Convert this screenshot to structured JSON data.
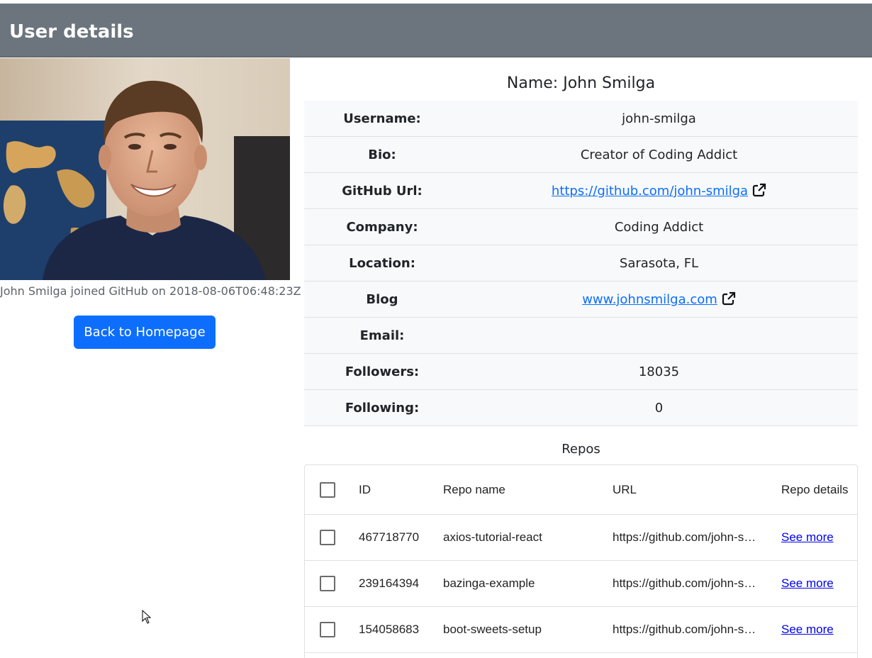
{
  "header": {
    "title": "User details"
  },
  "profile": {
    "joined_text": "John Smilga joined GitHub on 2018-08-06T06:48:23Z",
    "back_button": "Back to Homepage"
  },
  "details": {
    "name_title": "Name: John Smilga",
    "rows": [
      {
        "label": "Username:",
        "value": "john-smilga"
      },
      {
        "label": "Bio:",
        "value": "Creator of Coding Addict"
      },
      {
        "label": "GitHub Url:",
        "value": "https://github.com/john-smilga"
      },
      {
        "label": "Company:",
        "value": "Coding Addict"
      },
      {
        "label": "Location:",
        "value": "Sarasota, FL"
      },
      {
        "label": "Blog",
        "value": "www.johnsmilga.com"
      },
      {
        "label": "Email:",
        "value": ""
      },
      {
        "label": "Followers:",
        "value": "18035"
      },
      {
        "label": "Following:",
        "value": "0"
      }
    ]
  },
  "repos": {
    "title": "Repos",
    "columns": [
      "ID",
      "Repo name",
      "URL",
      "Repo details"
    ],
    "rows": [
      {
        "id": "467718770",
        "name": "axios-tutorial-react",
        "url": "https://github.com/john-smilga/axios-tutorial-react",
        "details": "See more"
      },
      {
        "id": "239164394",
        "name": "bazinga-example",
        "url": "https://github.com/john-smilga/bazinga-example",
        "details": "See more"
      },
      {
        "id": "154058683",
        "name": "boot-sweets-setup",
        "url": "https://github.com/john-smilga/boot-sweets-setup",
        "details": "See more"
      }
    ]
  },
  "colors": {
    "header_bg": "#6c757d",
    "primary": "#0d6efd",
    "row_bg": "#f8f9fa"
  },
  "icons": [
    "external-link-icon",
    "checkbox-icon",
    "cursor-icon"
  ]
}
